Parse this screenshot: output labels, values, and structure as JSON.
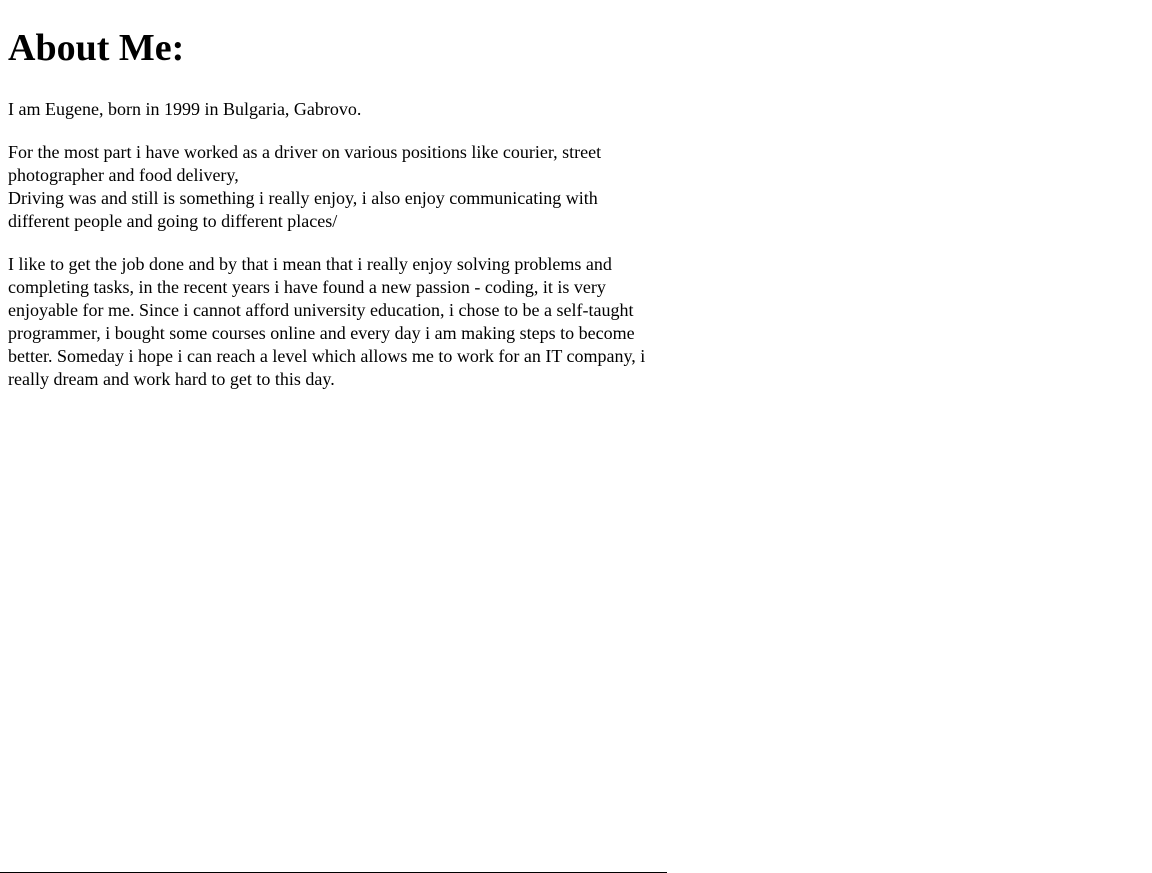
{
  "heading": "About Me:",
  "paragraphs": {
    "intro": "I am Eugene, born in 1999 in Bulgaria, Gabrovo.",
    "work_line1": "For the most part i have worked as a driver on various positions like courier, street photographer and food delivery,",
    "work_line2": "Driving was and still is something i really enjoy, i also enjoy communicating with different people and going to different places/",
    "passion": "I like to get the job done and by that i mean that i really enjoy solving problems and completing tasks, in the recent years i have found a new passion - coding, it is very enjoyable for me. Since i cannot afford university education, i chose to be a self-taught programmer, i bought some courses online and every day i am making steps to become better. Someday i hope i can reach a level which allows me to work for an IT company, i really dream and work hard to get to this day."
  }
}
